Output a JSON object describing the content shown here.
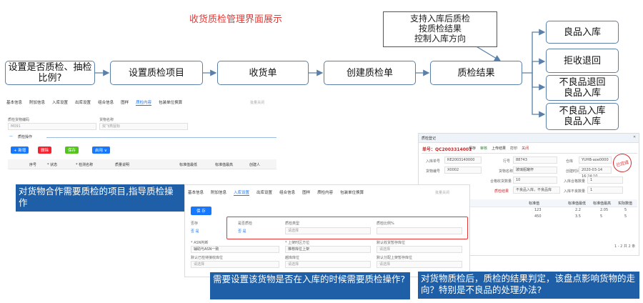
{
  "title": "收货质检管理界面展示",
  "flow": {
    "steps": [
      "设置是否质检、抽检比例?",
      "设置质检项目",
      "收货单",
      "创建质检单",
      "质检结果"
    ],
    "callout": [
      "支持入库后质检",
      "按质检结果",
      "控制入库方向"
    ],
    "outcomes": [
      "良品入库",
      "拒收退回",
      "不良品退回\n良品入库",
      "不良品入库\n良品入库"
    ]
  },
  "shot1": {
    "tabs": [
      "基本信息",
      "附加信息",
      "入库设置",
      "出库设置",
      "组合信息",
      "图样",
      "质检内容",
      "包装单位换算"
    ],
    "active_tab": "质检内容",
    "right_link": "批量关闭",
    "fields": [
      {
        "label": "质检货物编码",
        "value": "M091"
      },
      {
        "label": "货物名称",
        "value": "双飞燕鼠标"
      }
    ],
    "section": "质检操作",
    "buttons": [
      "+ 新增",
      "删除",
      "保存",
      "启用 ∨"
    ],
    "columns": [
      "序号",
      "* 状态",
      "* 检测名称",
      "质量说明",
      "标准值最低",
      "标准值最高",
      "创建人"
    ]
  },
  "shot2": {
    "tabs": [
      "基本信息",
      "附加信息",
      "入库设置",
      "出库设置",
      "组合信息",
      "图样",
      "质检内容",
      "包装单位换算"
    ],
    "active_tab": "入库设置",
    "right_link": "批量关闭",
    "save": "保 存",
    "fields": [
      {
        "label": "是否质检",
        "value": "否   是"
      },
      {
        "label": "质检类型",
        "value": "请选择"
      },
      {
        "label": "质检比例%",
        "value": ""
      },
      {
        "label": "* ASN判断",
        "value": "辅助与ASN一致"
      },
      {
        "label": "* 上架时区方位",
        "value": "推荐库位上架"
      },
      {
        "label": "默认收货暂存库位",
        "value": "请选择"
      },
      {
        "label": "默认已检待接收库位",
        "value": "请选择"
      },
      {
        "label": "越库库位",
        "value": "请选择"
      },
      {
        "label": "默认分配上架暂存库位",
        "value": "请选择"
      }
    ],
    "toggle_label": "否存",
    "toggle_value": "否   是"
  },
  "shot3": {
    "window_title": "质检登记",
    "doc_no": "单号：QC2003314001",
    "toolbar": [
      "保存",
      "审核",
      "上传结果",
      "打印",
      "关闭"
    ],
    "fields": [
      {
        "label": "入库单号",
        "value": "RE2003140000"
      },
      {
        "label": "行号",
        "value": "88743"
      },
      {
        "label": "仓库",
        "value": "YUHB-aoe0000"
      },
      {
        "label": "货物编号",
        "value": "X0002"
      },
      {
        "label": "货物名称",
        "value": "玻璃瓶罐杯"
      },
      {
        "label": "创建时间",
        "value": "2020-03-14 16:24:10"
      },
      {
        "label": "合格收货数量",
        "value": "10"
      },
      {
        "label": "入库合格数量",
        "value": "1"
      },
      {
        "label": "质检结果",
        "value": "不良品入库，不良品库"
      },
      {
        "label": "入库不良数量",
        "value": "1"
      }
    ],
    "stamp": "已完成",
    "columns": [
      "标准值",
      "标准值最低",
      "标准值最高",
      "实际数值"
    ],
    "rows": [
      [
        "123",
        "2.2",
        "2.05",
        "5"
      ],
      [
        "450",
        "3.5",
        "5",
        "5"
      ]
    ],
    "pager": "1 - 2 共 2 条"
  },
  "notes": [
    "对货物合作需要质检的项目,指导质检操作",
    "需要设置该货物是否在入库的时候需要质检操作?",
    "对货物质检后，质检的结果判定，该盘点影响货物的走向？特别是不良品的处理办法?"
  ],
  "colors": {
    "box_border": "#5a7fa8",
    "title": "#e53935",
    "note_bg": "#1f5fa8",
    "highlight": "#e53935",
    "accent": "#1677ff"
  }
}
